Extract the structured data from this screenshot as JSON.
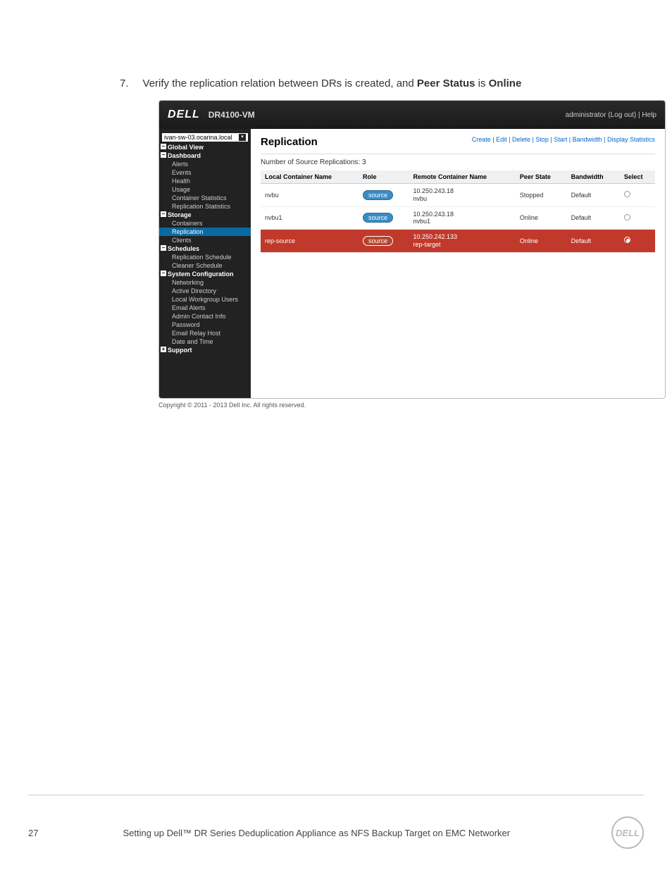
{
  "step": {
    "number": "7.",
    "prefix": "Verify the replication relation between DRs is created, and ",
    "b1": "Peer Status",
    "mid": " is ",
    "b2": "Online"
  },
  "topbar": {
    "logo": "DELL",
    "model": "DR4100-VM",
    "admin": "administrator",
    "logout": "(Log out)",
    "help": "Help"
  },
  "sidebar": {
    "host": "ivan-sw-03.ocarina.local",
    "groups": [
      {
        "label": "Global View",
        "children": []
      },
      {
        "label": "Dashboard",
        "children": [
          "Alerts",
          "Events",
          "Health",
          "Usage",
          "Container Statistics",
          "Replication Statistics"
        ]
      },
      {
        "label": "Storage",
        "children": [
          "Containers",
          "Replication",
          "Clients"
        ],
        "selected_idx": 1
      },
      {
        "label": "Schedules",
        "children": [
          "Replication Schedule",
          "Cleaner Schedule"
        ]
      },
      {
        "label": "System Configuration",
        "children": [
          "Networking",
          "Active Directory",
          "Local Workgroup Users",
          "Email Alerts",
          "Admin Contact Info",
          "Password",
          "Email Relay Host",
          "Date and Time"
        ]
      },
      {
        "label": "Support",
        "children": [],
        "plus": true
      }
    ]
  },
  "main": {
    "title": "Replication",
    "actions": [
      "Create",
      "Edit",
      "Delete",
      "Stop",
      "Start",
      "Bandwidth",
      "Display Statistics"
    ],
    "count_label": "Number of Source Replications: 3",
    "headers": [
      "Local Container Name",
      "Role",
      "Remote Container Name",
      "Peer State",
      "Bandwidth",
      "Select"
    ],
    "rows": [
      {
        "local": "nvbu",
        "role": "source",
        "remote_ip": "10.250.243.18",
        "remote_name": "nvbu",
        "peer": "Stopped",
        "bw": "Default",
        "sel": false
      },
      {
        "local": "nvbu1",
        "role": "source",
        "remote_ip": "10.250.243.18",
        "remote_name": "nvbu1",
        "peer": "Online",
        "bw": "Default",
        "sel": false
      },
      {
        "local": "rep-source",
        "role": "source",
        "remote_ip": "10.250.242.133",
        "remote_name": "rep-target",
        "peer": "Online",
        "bw": "Default",
        "sel": true
      }
    ]
  },
  "copyright": "Copyright © 2011 - 2013 Dell Inc. All rights reserved.",
  "footer": {
    "page": "27",
    "title": "Setting up Dell™ DR Series Deduplication Appliance as NFS Backup Target on EMC Networker",
    "logo": "DELL"
  }
}
